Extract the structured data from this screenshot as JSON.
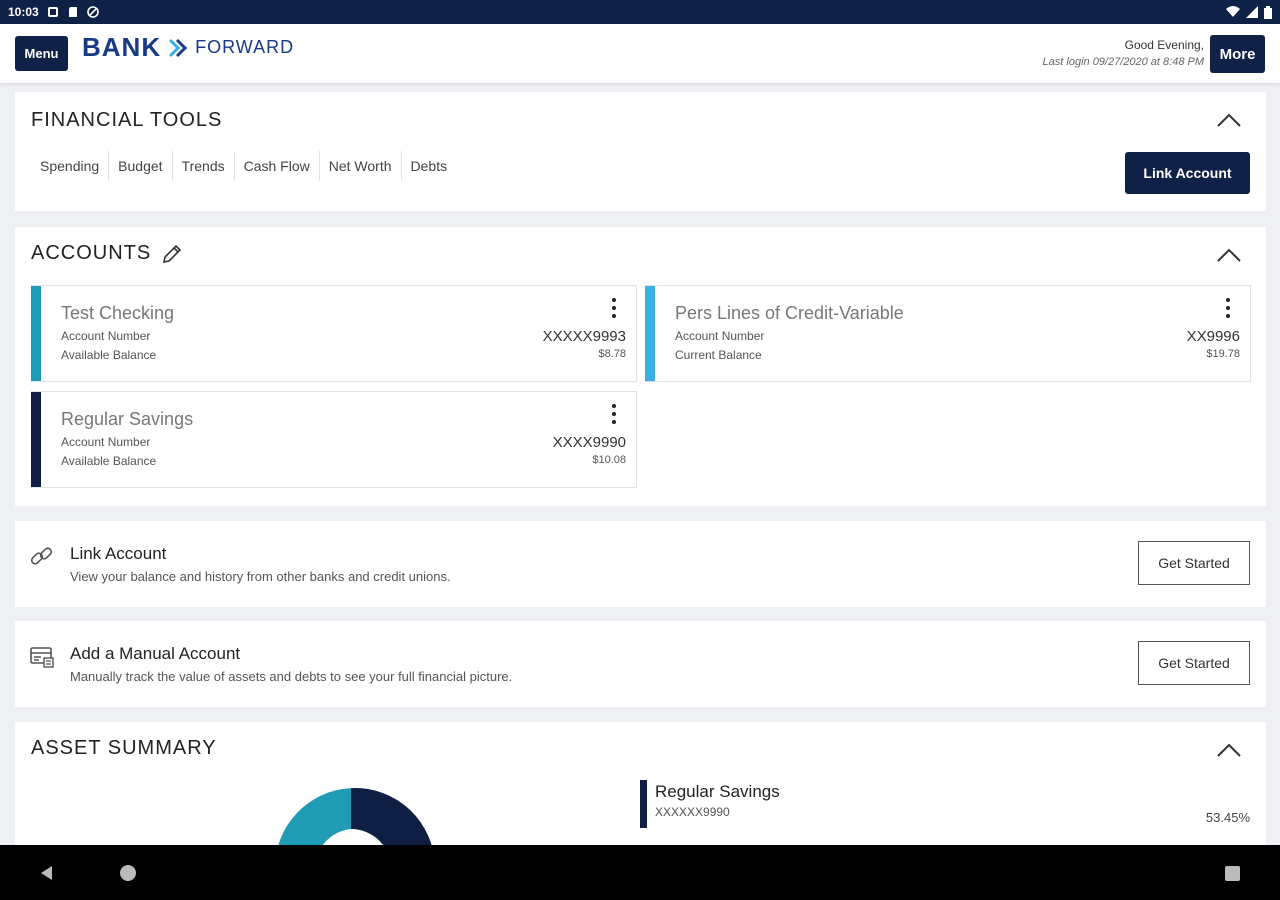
{
  "status_bar": {
    "time": "10:03"
  },
  "header": {
    "menu_label": "Menu",
    "logo_bank": "BANK",
    "logo_forward": "FORWARD",
    "greeting": "Good Evening,",
    "last_login": "Last login 09/27/2020 at 8:48 PM",
    "more_label": "More"
  },
  "financial_tools": {
    "title": "FINANCIAL TOOLS",
    "tabs": [
      "Spending",
      "Budget",
      "Trends",
      "Cash Flow",
      "Net Worth",
      "Debts"
    ],
    "link_account_label": "Link Account"
  },
  "accounts": {
    "title": "ACCOUNTS",
    "items": [
      {
        "name": "Test Checking",
        "number_label": "Account Number",
        "balance_label": "Available Balance",
        "number": "XXXXX9993",
        "balance": "$8.78",
        "color": "#1f9bb6"
      },
      {
        "name": "Pers Lines of Credit-Variable",
        "number_label": "Account Number",
        "balance_label": "Current Balance",
        "number": "XX9996",
        "balance": "$19.78",
        "color": "#3ab0e2"
      },
      {
        "name": "Regular Savings",
        "number_label": "Account Number",
        "balance_label": "Available Balance",
        "number": "XXXX9990",
        "balance": "$10.08",
        "color": "#0f1f44"
      }
    ]
  },
  "promos": [
    {
      "title": "Link Account",
      "description": "View your balance and history from other banks and credit unions.",
      "button": "Get Started"
    },
    {
      "title": "Add a Manual Account",
      "description": "Manually track the value of assets and debts to see your full financial picture.",
      "button": "Get Started"
    }
  ],
  "asset_summary": {
    "title": "ASSET SUMMARY",
    "legend": {
      "name": "Regular Savings",
      "number": "XXXXXX9990",
      "percent": "53.45%"
    },
    "colors": {
      "primary": "#0f1f44",
      "secondary": "#1f9bb6"
    }
  },
  "colors": {
    "brand_navy": "#0f2147",
    "logo_blue": "#173a86",
    "accent_cyan": "#3ab0e2"
  }
}
